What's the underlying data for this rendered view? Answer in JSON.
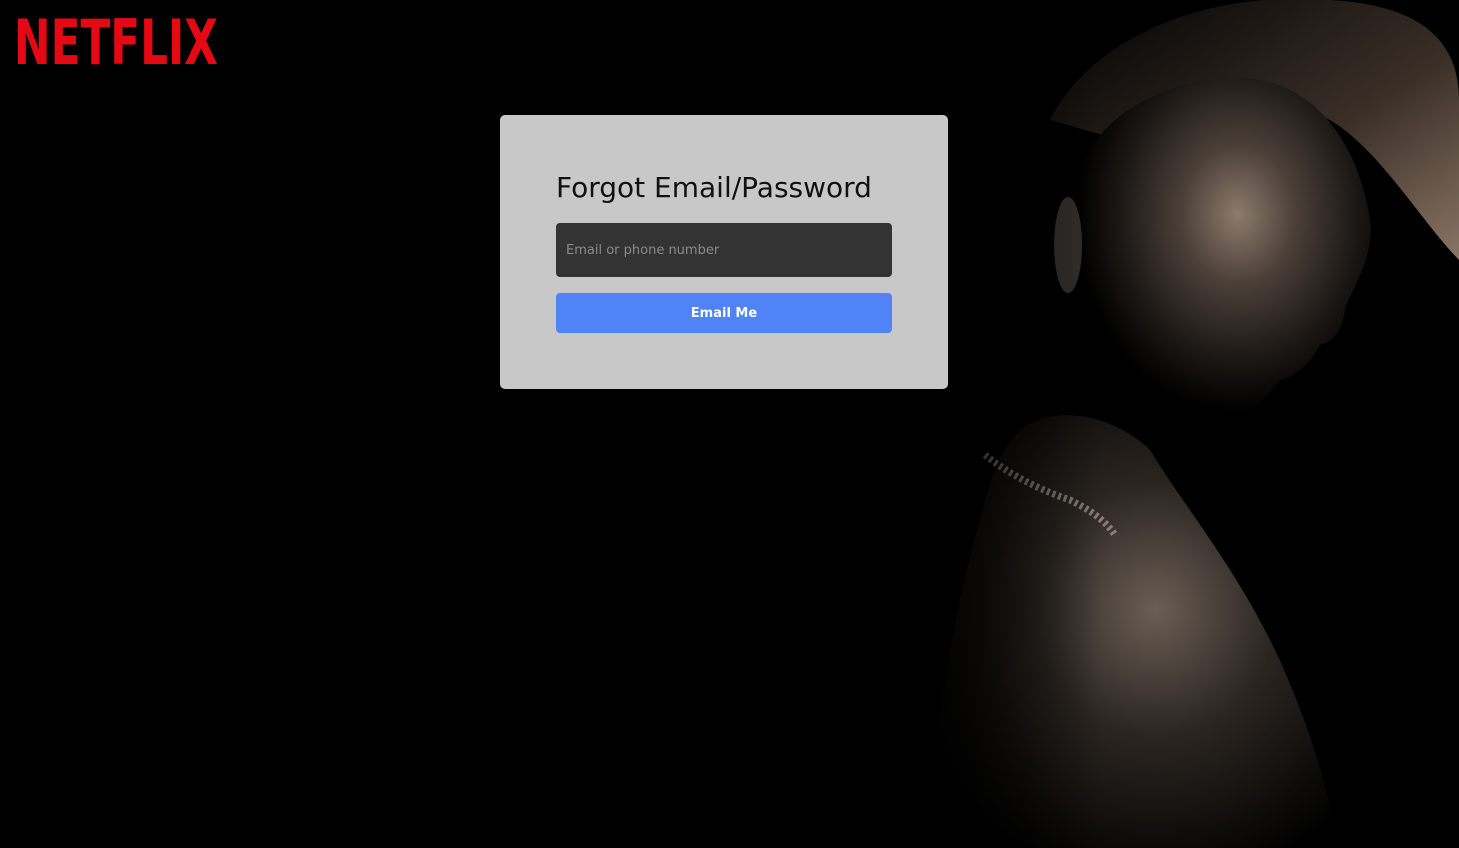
{
  "brand": {
    "name": "NETFLIX",
    "color": "#e50914"
  },
  "background": {
    "description_icon": "portrait-photo"
  },
  "forgot_form": {
    "title": "Forgot Email/Password",
    "email_placeholder": "Email or phone number",
    "email_value": "",
    "submit_label": "Email Me"
  },
  "colors": {
    "card_bg": "#c8c8c8",
    "input_bg": "#333333",
    "button_bg": "#5083f5",
    "page_bg": "#000000"
  }
}
